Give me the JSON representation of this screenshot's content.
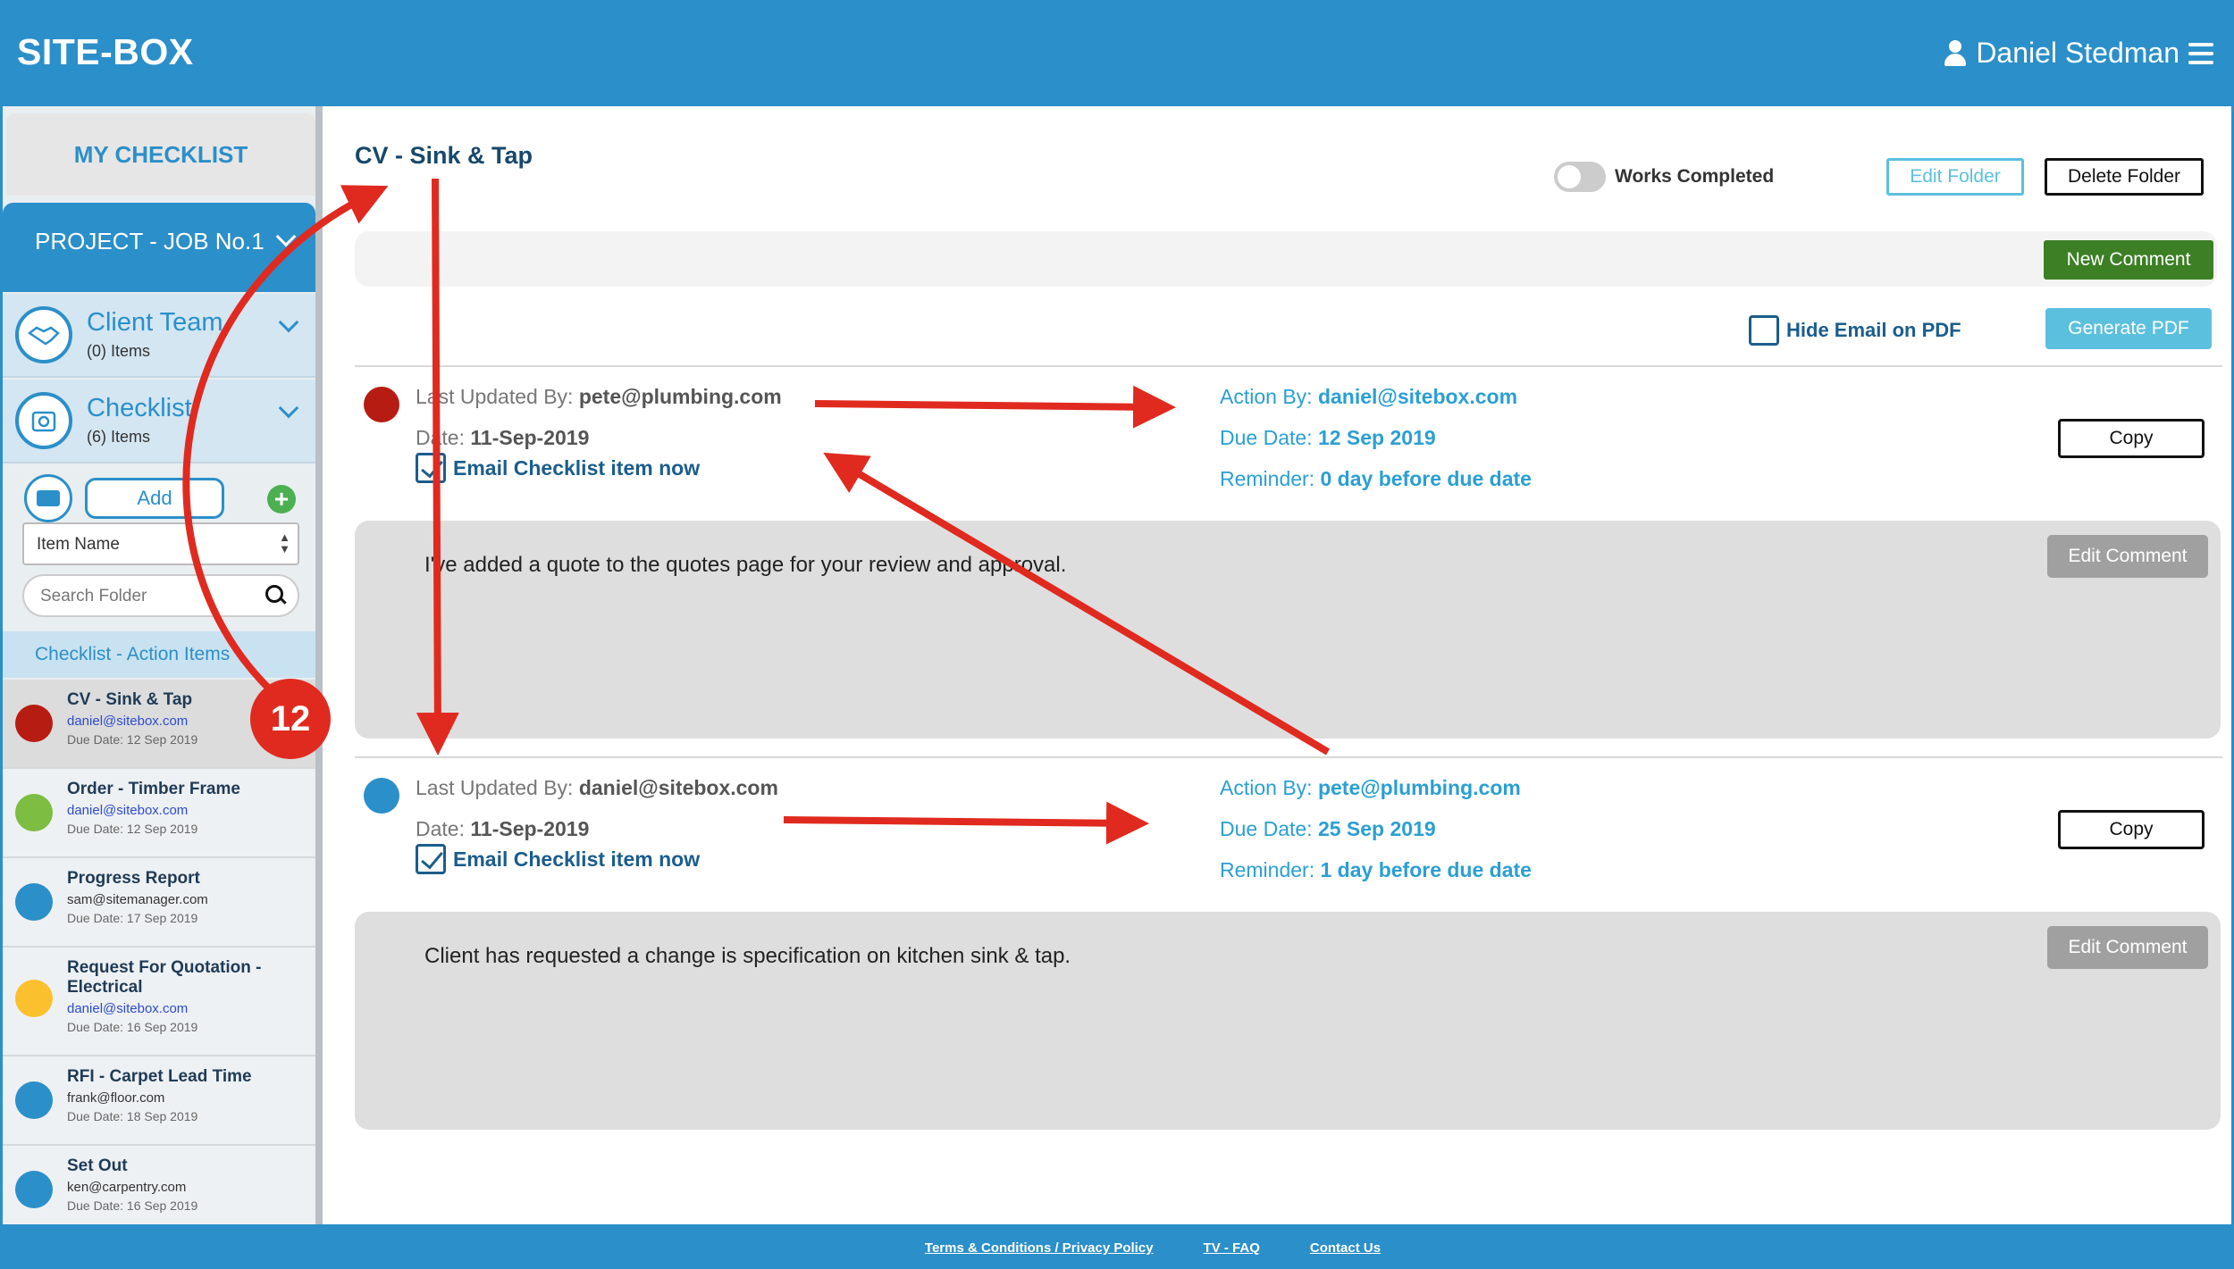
{
  "header": {
    "brand": "SITE-BOX",
    "user_name": "Daniel Stedman"
  },
  "sidebar": {
    "my_checklist": "MY CHECKLIST",
    "project": "PROJECT - JOB No.1",
    "sections": [
      {
        "title": "Client Team",
        "count": "(0) Items"
      },
      {
        "title": "Checklist",
        "count": "(6) Items"
      }
    ],
    "add_label": "Add",
    "sort_select": "Item Name",
    "search_placeholder": "Search Folder",
    "list_header": "Checklist - Action Items",
    "items": [
      {
        "name": "CV - Sink & Tap",
        "email": "daniel@sitebox.com",
        "due": "Due Date: 12 Sep 2019",
        "color": "#b71c12"
      },
      {
        "name": "Order - Timber Frame",
        "email": "daniel@sitebox.com",
        "due": "Due Date: 12 Sep 2019",
        "color": "#7cbd42"
      },
      {
        "name": "Progress Report",
        "email": "sam@sitemanager.com",
        "due": "Due Date: 17 Sep 2019",
        "color": "#2b8fc9"
      },
      {
        "name": "Request For Quotation - Electrical",
        "email": "daniel@sitebox.com",
        "due": "Due Date: 16 Sep 2019",
        "color": "#fbc02d"
      },
      {
        "name": "RFI - Carpet Lead Time",
        "email": "frank@floor.com",
        "due": "Due Date: 18 Sep 2019",
        "color": "#2b8fc9"
      },
      {
        "name": "Set Out",
        "email": "ken@carpentry.com",
        "due": "Due Date: 16 Sep 2019",
        "color": "#2b8fc9"
      }
    ]
  },
  "main": {
    "folder_title": "CV - Sink & Tap",
    "works_completed": "Works Completed",
    "edit_folder": "Edit Folder",
    "delete_folder": "Delete Folder",
    "new_comment": "New Comment",
    "hide_email": "Hide Email on PDF",
    "generate_pdf": "Generate PDF",
    "entries": [
      {
        "dot_color": "#b71c12",
        "updated_label": "Last Updated By:",
        "updated_by": "pete@plumbing.com",
        "date_label": "Date:",
        "date": "11-Sep-2019",
        "email_now": "Email Checklist item now",
        "action_label": "Action By:",
        "action_by": "daniel@sitebox.com",
        "due_label": "Due Date:",
        "due": "12 Sep 2019",
        "reminder_label": "Reminder:",
        "reminder": "0 day before due date",
        "copy": "Copy",
        "comment": "I've added a quote to the quotes page for your review and approval.",
        "edit_comment": "Edit Comment"
      },
      {
        "dot_color": "#2b8fc9",
        "updated_label": "Last Updated By:",
        "updated_by": "daniel@sitebox.com",
        "date_label": "Date:",
        "date": "11-Sep-2019",
        "email_now": "Email Checklist item now",
        "action_label": "Action By:",
        "action_by": "pete@plumbing.com",
        "due_label": "Due Date:",
        "due": "25 Sep 2019",
        "reminder_label": "Reminder:",
        "reminder": "1 day before due date",
        "copy": "Copy",
        "comment": "Client has requested a change is specification on kitchen sink & tap.",
        "edit_comment": "Edit Comment"
      }
    ]
  },
  "footer": {
    "terms": "Terms & Conditions / Privacy Policy",
    "faq": "TV - FAQ",
    "contact": "Contact Us"
  },
  "annotation": {
    "badge": "12",
    "arrow_color": "#e02a1f"
  }
}
